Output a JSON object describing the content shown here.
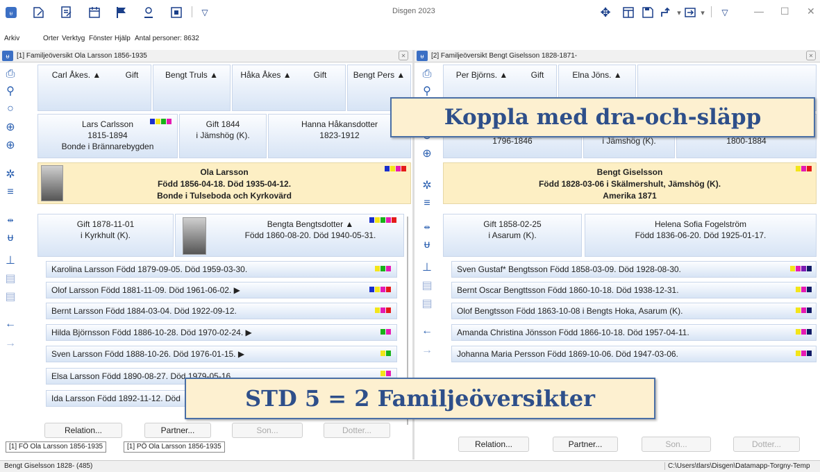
{
  "app": {
    "title": "Disgen 2023"
  },
  "menu": {
    "arkiv": "Arkiv",
    "orter": "Orter",
    "verktyg": "Verktyg",
    "fonster": "Fönster",
    "hjalp": "Hjälp",
    "antal": "Antal personer: 8632"
  },
  "colors": {
    "accent": "#2a5fb0",
    "banner_bg": "#fdf0d0",
    "main_person_bg": "#fdefc4"
  },
  "left": {
    "title": "[1] Familjeöversikt Ola Larsson 1856-1935",
    "grand": [
      "Carl Åkes. ▲",
      "Gift",
      "Bengt Truls ▲",
      "Håka Åkes ▲",
      "Gift",
      "Bengt Pers ▲"
    ],
    "father": {
      "name": "Lars Carlsson",
      "years": "1815-1894",
      "note": "Bonde i Brännarebygden"
    },
    "marriage_parents": {
      "l1": "Gift 1844",
      "l2": "i Jämshög (K)."
    },
    "mother": {
      "name": "Hanna Håkansdotter",
      "years": "1823-1912"
    },
    "main": {
      "name": "Ola Larsson",
      "l2": "Född 1856-04-18. Död 1935-04-12.",
      "l3": "Bonde i Tulseboda och Kyrkovärd"
    },
    "marriage": {
      "l1": "Gift 1878-11-01",
      "l2": "i Kyrkhult (K)."
    },
    "spouse": {
      "l1": "Bengta Bengtsdotter ▲",
      "l2": "Född 1860-08-20. Död 1940-05-31."
    },
    "children": [
      "Karolina Larsson Född 1879-09-05. Död 1959-03-30.",
      "Olof Larsson Född 1881-11-09. Död 1961-06-02. ▶",
      "Bernt Larsson Född 1884-03-04. Död 1922-09-12.",
      "Hilda Björnsson Född 1886-10-28. Död 1970-02-24. ▶",
      "Sven Larsson Född 1888-10-26. Död 1976-01-15. ▶",
      "Elsa Larsson Född 1890-08-27. Död 1979-05-16",
      "Ida Larsson Född 1892-11-12. Död"
    ],
    "buttons": [
      "Relation...",
      "Partner...",
      "Son...",
      "Dotter..."
    ],
    "tabs": [
      "[1] FÖ Ola Larsson 1856-1935",
      "[1] PÖ Ola Larsson 1856-1935"
    ]
  },
  "right": {
    "title": "[2] Familjeöversikt Bengt Giselsson 1828-1871-",
    "grand": [
      "Per Björns. ▲",
      "Gift",
      "Elna Jöns. ▲"
    ],
    "father_years": "1796-1846",
    "marriage_parents": "i Jämshög (K).",
    "mother_years": "1800-1884",
    "main": {
      "name": "Bengt Giselsson",
      "l2": "Född 1828-03-06 i Skälmershult, Jämshög (K).",
      "l3": "Amerika 1871"
    },
    "marriage": {
      "l1": "Gift 1858-02-25",
      "l2": "i Asarum (K)."
    },
    "spouse": {
      "l1": "Helena Sofia Fogelström",
      "l2": "Född 1836-06-20. Död 1925-01-17."
    },
    "children": [
      "Sven Gustaf* Bengtsson Född 1858-03-09. Död 1928-08-30.",
      "Bernt Oscar Bengttsson Född 1860-10-18. Död 1938-12-31.",
      "Olof Bengtsson Född 1863-10-08 i Bengts Hoka, Asarum (K).",
      "Amanda Christina Jönsson Född 1866-10-18. Död 1957-04-11.",
      "Johanna Maria Persson Född 1869-10-06. Död 1947-03-06."
    ],
    "buttons": [
      "Relation...",
      "Partner...",
      "Son...",
      "Dotter..."
    ]
  },
  "banners": {
    "drag": "Koppla med dra-och-släpp",
    "std": "STD 5 = 2 Familjeöversikter"
  },
  "status": {
    "left": "Bengt Giselsson 1828- (485)",
    "right": "C:\\Users\\tlars\\Disgen\\Datamapp-Torgny-Temp"
  }
}
